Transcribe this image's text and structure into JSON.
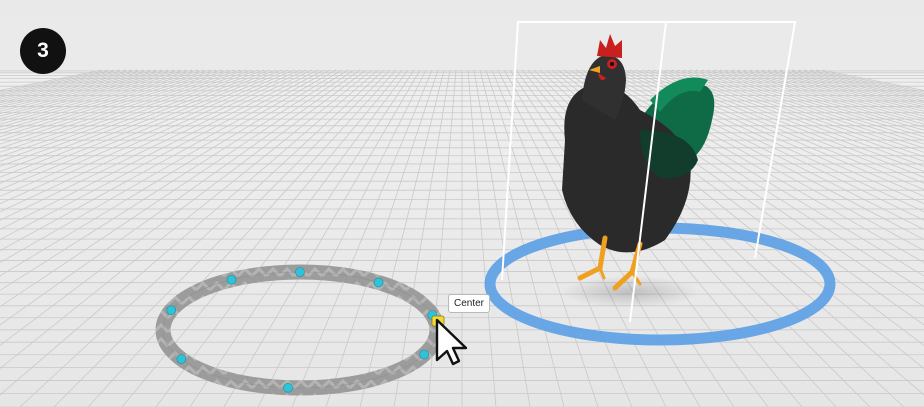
{
  "step": {
    "number": "3"
  },
  "tooltip": {
    "label": "Center"
  },
  "colors": {
    "sky": "#e8e8e8",
    "floor": "#ececec",
    "grid": "#c8c8c8",
    "path_ring": "#9a9a9a",
    "path_marker": "#2fc3d9",
    "selection_ring": "#5b9ee6",
    "selected_handle": "#f0d93a",
    "rooster_body": "#2a2a2a",
    "rooster_comb": "#c8201e",
    "rooster_tail": "#0f6b46",
    "rooster_legs": "#f0a020"
  },
  "icons": {
    "cursor": "arrow-cursor-icon"
  }
}
